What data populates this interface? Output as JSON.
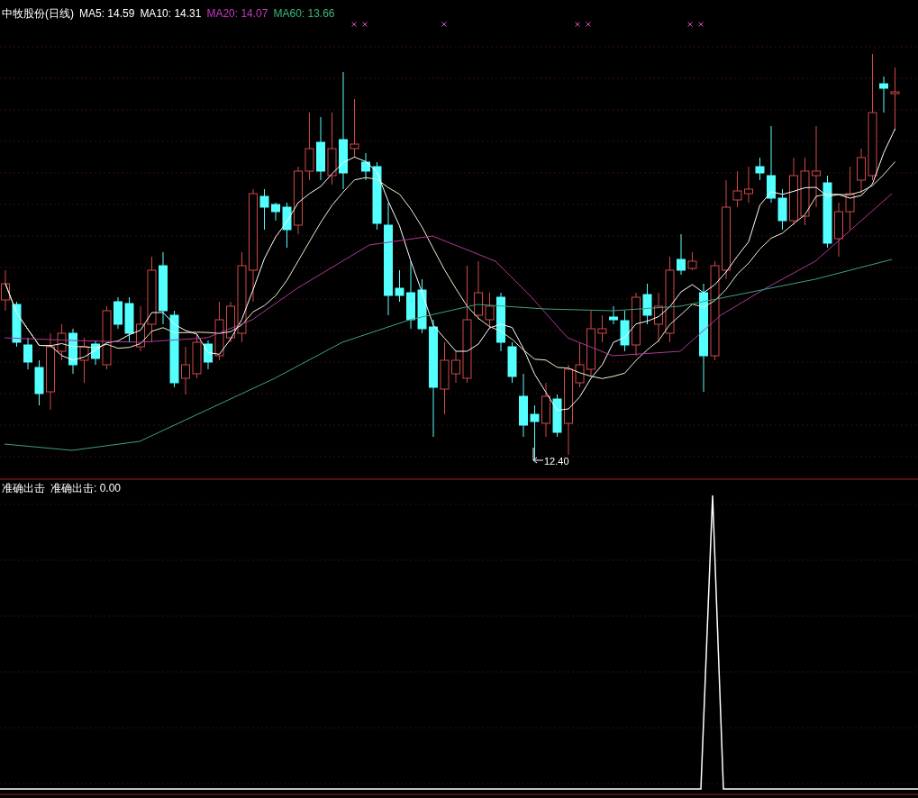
{
  "header": {
    "title": "中牧股份(日线)",
    "indicators": [
      {
        "label": "MA5: 14.59",
        "color": "#ffffff"
      },
      {
        "label": "MA10: 14.31",
        "color": "#ffffff"
      },
      {
        "label": "MA20: 14.07",
        "color": "#c838c0"
      },
      {
        "label": "MA60: 13.66",
        "color": "#3cb878"
      }
    ]
  },
  "price_panel": {
    "low_label": "12.40"
  },
  "indicator_panel": {
    "title": "准确出击",
    "reading": "准确出击: 0.00"
  }
}
